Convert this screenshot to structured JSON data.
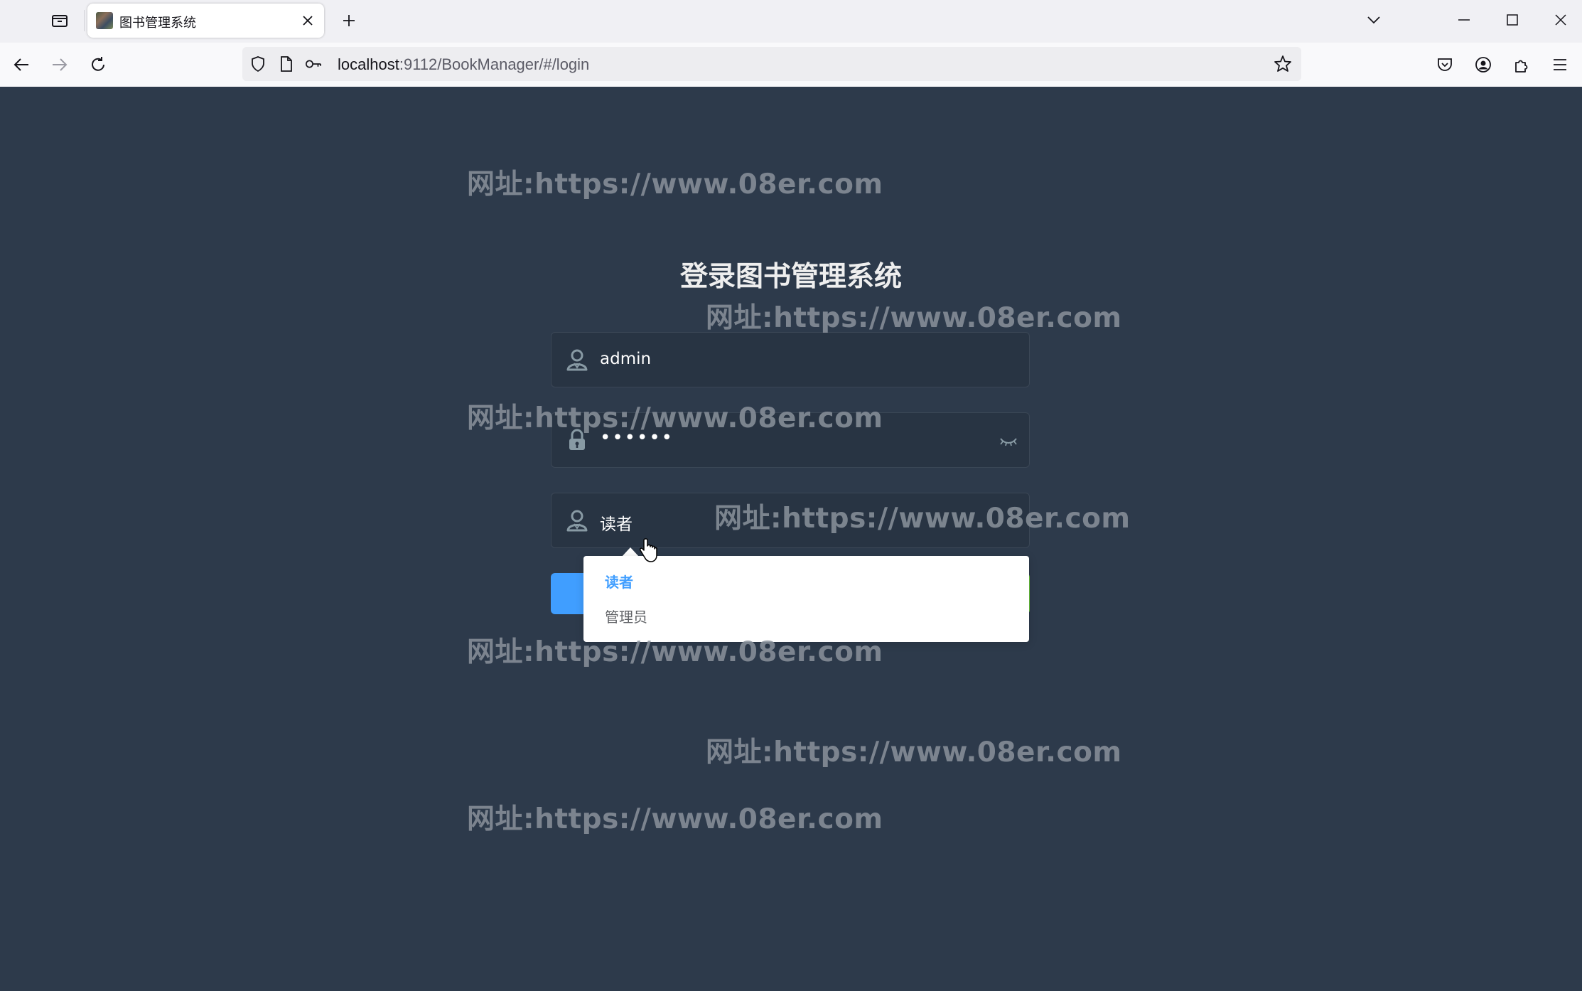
{
  "browser": {
    "tab": {
      "title": "图书管理系统"
    },
    "address": {
      "host": "localhost",
      "rest": ":9112/BookManager/#/login"
    }
  },
  "page": {
    "title": "登录图书管理系统",
    "username": {
      "value": "admin"
    },
    "password": {
      "masked": "••••••"
    },
    "role": {
      "value": "读者",
      "options": [
        {
          "label": "读者",
          "selected": true
        },
        {
          "label": "管理员",
          "selected": false
        }
      ]
    }
  },
  "watermark": {
    "text": "网址:https://www.08er.com"
  },
  "colors": {
    "background": "#2d3a4b",
    "field_bg": "#283443",
    "primary": "#409eff",
    "success": "#67c23a",
    "title": "#eeeeee"
  },
  "icons": [
    "tab-overview-icon",
    "close-icon",
    "plus-icon",
    "chevron-down-icon",
    "minimize-icon",
    "maximize-icon",
    "back-icon",
    "forward-icon",
    "reload-icon",
    "shield-icon",
    "page-icon",
    "key-icon",
    "star-icon",
    "pocket-icon",
    "account-icon",
    "extensions-icon",
    "menu-icon",
    "user-icon",
    "lock-icon",
    "eye-closed-icon",
    "pointer-cursor-icon"
  ]
}
